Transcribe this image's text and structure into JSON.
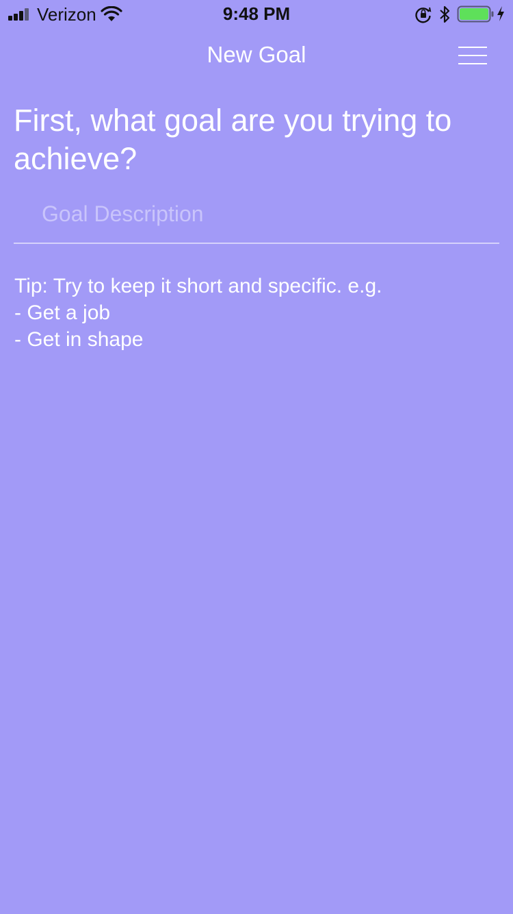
{
  "status_bar": {
    "carrier": "Verizon",
    "time": "9:48 PM",
    "icons": [
      "signal-icon",
      "wifi-icon",
      "orientation-lock-icon",
      "bluetooth-icon",
      "battery-icon",
      "charging-bolt-icon"
    ],
    "battery_color": "#5ee05a"
  },
  "nav": {
    "title": "New Goal",
    "menu_icon": "hamburger-menu-icon"
  },
  "form": {
    "question": "First, what goal are you trying to achieve?",
    "goal_input": {
      "value": "",
      "placeholder": "Goal Description"
    }
  },
  "tip": {
    "lines": [
      "Tip: Try to keep it short and specific. e.g.",
      "- Get a job",
      "- Get in shape"
    ]
  },
  "colors": {
    "background": "#a29af7",
    "text": "#ffffff",
    "placeholder": "#c9c4fb"
  }
}
